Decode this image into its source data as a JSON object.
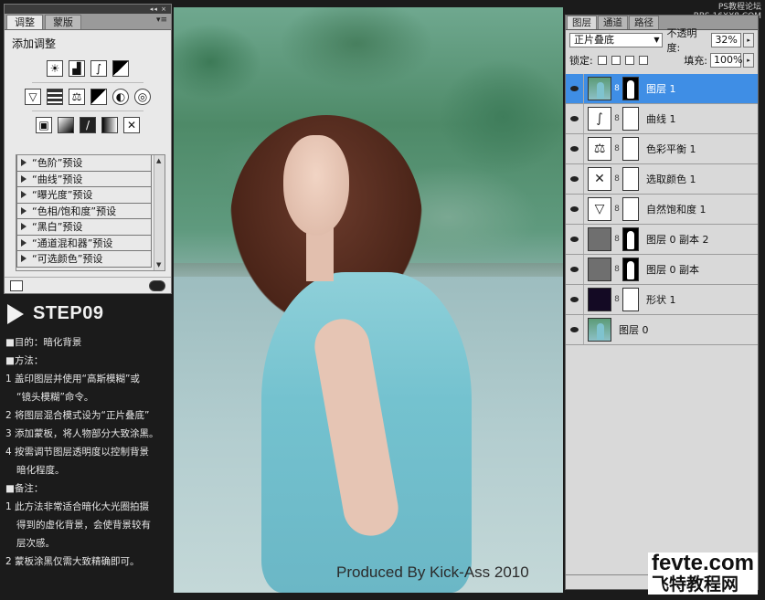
{
  "adjustments": {
    "tabs": [
      "调整",
      "蒙版"
    ],
    "title": "添加调整",
    "presets": [
      "“色阶”预设",
      "“曲线”预设",
      "“曝光度”预设",
      "“色相/饱和度”预设",
      "“黑白”预设",
      "“通道混和器”预设",
      "“可选颜色”预设"
    ],
    "icons_row1": [
      "brightness-icon",
      "levels-icon",
      "curves-icon",
      "exposure-icon"
    ],
    "icons_row2": [
      "vibrance-icon",
      "hue-saturation-icon",
      "color-balance-icon",
      "black-white-icon",
      "photo-filter-icon",
      "channel-mixer-icon"
    ],
    "icons_row3": [
      "invert-icon",
      "posterize-icon",
      "threshold-icon",
      "gradient-map-icon",
      "selective-color-icon"
    ]
  },
  "step": {
    "title": "STEP09",
    "lines": [
      {
        "text": "■目的：暗化背景",
        "indent": false
      },
      {
        "text": "■方法：",
        "indent": false
      },
      {
        "text": "1 盖印图层并使用“高斯模糊”或",
        "indent": false
      },
      {
        "text": "“镜头模糊”命令。",
        "indent": true
      },
      {
        "text": "2 将图层混合模式设为“正片叠底”",
        "indent": false
      },
      {
        "text": "3 添加蒙板，将人物部分大致涂黑。",
        "indent": false
      },
      {
        "text": "4 按需调节图层透明度以控制背景",
        "indent": false
      },
      {
        "text": "暗化程度。",
        "indent": true
      },
      {
        "text": "■备注：",
        "indent": false
      },
      {
        "text": "1 此方法非常适合暗化大光圈拍摄",
        "indent": false
      },
      {
        "text": "得到的虚化背景，会使背景较有",
        "indent": true
      },
      {
        "text": "层次感。",
        "indent": true
      },
      {
        "text": "2 蒙板涂黑仅需大致精确即可。",
        "indent": false
      }
    ]
  },
  "photo": {
    "credit": "Produced By Kick-Ass 2010"
  },
  "layers": {
    "tabs": [
      "图层",
      "通道",
      "路径"
    ],
    "blend_mode": "正片叠底",
    "opacity_label": "不透明度:",
    "opacity_value": "32%",
    "lock_label": "锁定:",
    "fill_label": "填充:",
    "fill_value": "100%",
    "items": [
      {
        "name": "图层 1",
        "selected": true
      },
      {
        "name": "曲线 1",
        "selected": false
      },
      {
        "name": "色彩平衡 1",
        "selected": false
      },
      {
        "name": "选取颜色 1",
        "selected": false
      },
      {
        "name": "自然饱和度 1",
        "selected": false
      },
      {
        "name": "图层 0 副本 2",
        "selected": false
      },
      {
        "name": "图层 0 副本",
        "selected": false
      },
      {
        "name": "形状 1",
        "selected": false
      },
      {
        "name": "图层 0",
        "selected": false
      }
    ]
  },
  "watermarks": {
    "top_line1": "PS教程论坛",
    "top_line2": "BBS.16XX8.COM",
    "bottom_line1": "fevte.com",
    "bottom_line2": "飞特教程网"
  }
}
